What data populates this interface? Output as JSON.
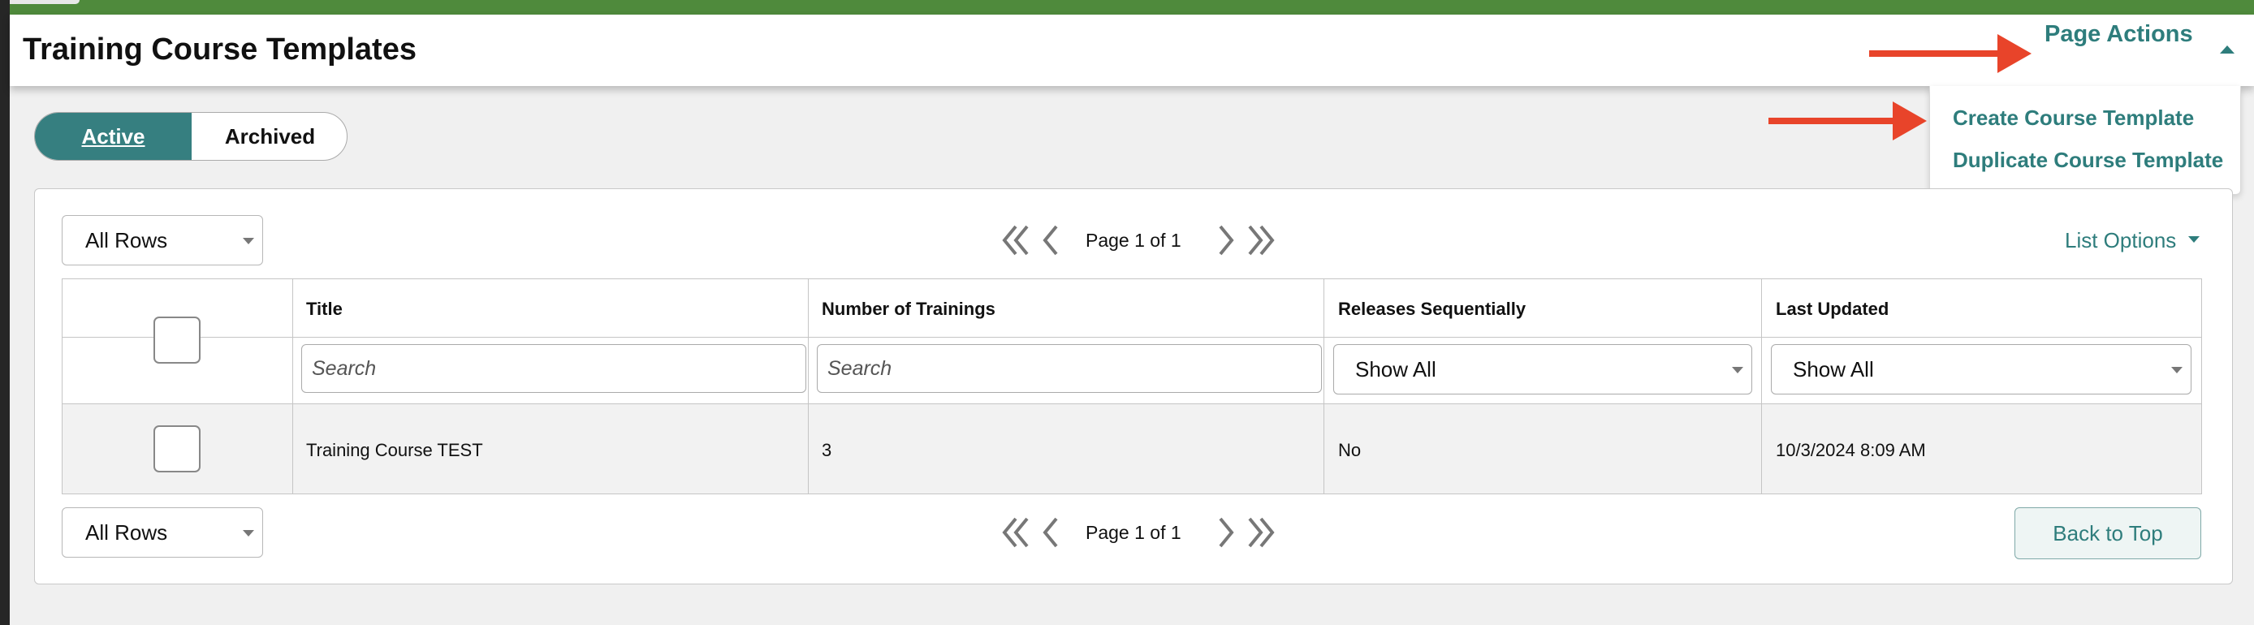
{
  "page": {
    "title": "Training Course Templates",
    "page_actions_label": "Page Actions"
  },
  "page_actions_menu": {
    "items": [
      {
        "label": "Create Course Template"
      },
      {
        "label": "Duplicate Course Template"
      }
    ]
  },
  "status_toggle": {
    "active_label": "Active",
    "archived_label": "Archived",
    "selected": "Active"
  },
  "list": {
    "rows_select_value": "All Rows",
    "pagination_text": "Page 1 of 1",
    "list_options_label": "List Options",
    "back_to_top_label": "Back to Top",
    "columns": [
      {
        "label": "Title",
        "filter_type": "search",
        "filter_placeholder": "Search"
      },
      {
        "label": "Number of Trainings",
        "filter_type": "search",
        "filter_placeholder": "Search"
      },
      {
        "label": "Releases Sequentially",
        "filter_type": "select",
        "filter_value": "Show All"
      },
      {
        "label": "Last Updated",
        "filter_type": "select",
        "filter_value": "Show All"
      }
    ],
    "rows": [
      {
        "title": "Training Course TEST",
        "number_of_trainings": "3",
        "releases_sequentially": "No",
        "last_updated": "10/3/2024 8:09 AM"
      }
    ]
  },
  "colors": {
    "brand_green": "#4f8a3c",
    "accent_teal": "#2e7d7c",
    "toggle_active_bg": "#367f80",
    "annotation_arrow": "#e8442a"
  }
}
